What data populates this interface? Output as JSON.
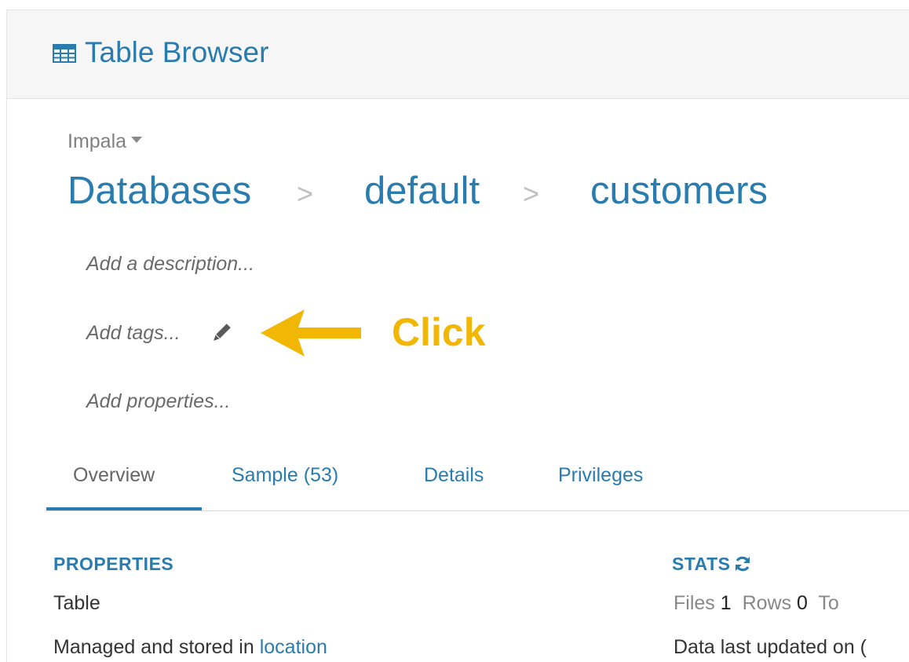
{
  "header": {
    "icon": "table-grid-icon",
    "title": "Table Browser"
  },
  "source": {
    "selected": "Impala"
  },
  "breadcrumb": {
    "items": [
      "Databases",
      "default",
      "customers"
    ],
    "separator": ">"
  },
  "metadata": {
    "description_placeholder": "Add a description...",
    "tags_placeholder": "Add tags...",
    "properties_placeholder": "Add properties..."
  },
  "annotation": {
    "label": "Click",
    "color": "#f2b705"
  },
  "tabs": [
    {
      "label": "Overview",
      "active": true
    },
    {
      "label": "Sample (53)",
      "active": false
    },
    {
      "label": "Details",
      "active": false
    },
    {
      "label": "Privileges",
      "active": false
    }
  ],
  "properties": {
    "title": "PROPERTIES",
    "type": "Table",
    "storage_prefix": "Managed and stored in",
    "storage_link": "location"
  },
  "stats": {
    "title": "STATS",
    "files_label": "Files",
    "files_value": "1",
    "rows_label": "Rows",
    "rows_value": "0",
    "total_label_partial": "To",
    "updated_text_partial": "Data last updated on ("
  },
  "colors": {
    "accent": "#2a7cae",
    "muted": "#808080"
  }
}
